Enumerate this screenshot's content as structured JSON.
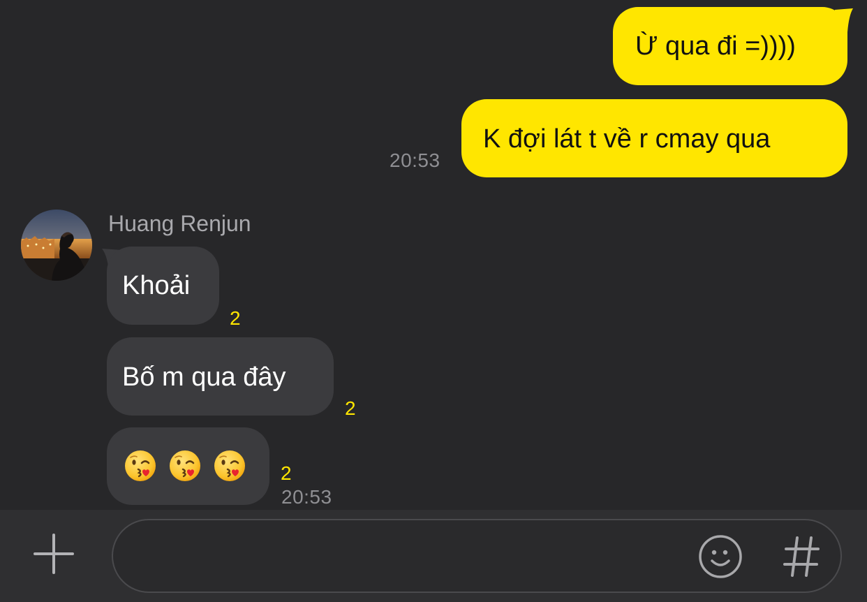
{
  "messages": {
    "outgoing": [
      {
        "text": "Ừ qua đi =))))"
      },
      {
        "text": "K đợi lát t về r cmay qua",
        "time": "20:53"
      }
    ],
    "incoming_sender": "Huang Renjun",
    "incoming": [
      {
        "text": "Khoải",
        "unread": "2"
      },
      {
        "text": "Bố m qua đây",
        "unread": "2"
      },
      {
        "emoji": [
          "kissing-heart-face",
          "kissing-heart-face",
          "kissing-heart-face"
        ],
        "unread": "2",
        "time": "20:53"
      }
    ]
  },
  "input_bar": {
    "placeholder": "",
    "value": "",
    "icons": [
      "plus-icon",
      "smiley-icon",
      "hashtag-icon"
    ]
  },
  "colors": {
    "background": "#272729",
    "outgoing_bubble": "#ffe600",
    "incoming_bubble": "#3b3b3e",
    "unread_count": "#ffe600",
    "timestamp": "#8f8f93"
  }
}
